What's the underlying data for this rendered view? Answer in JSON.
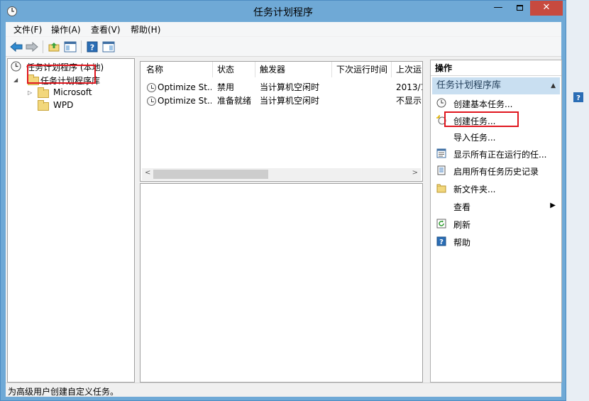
{
  "window": {
    "title": "任务计划程序",
    "min_glyph": "—",
    "close_glyph": "✕"
  },
  "menu": [
    "文件(F)",
    "操作(A)",
    "查看(V)",
    "帮助(H)"
  ],
  "tree": {
    "root": "任务计划程序 (本地)",
    "library": "任务计划程序库",
    "children": [
      "Microsoft",
      "WPD"
    ]
  },
  "task_table": {
    "columns": [
      "名称",
      "状态",
      "触发器",
      "下次运行时间",
      "上次运"
    ],
    "rows": [
      [
        "Optimize St...",
        "禁用",
        "当计算机空闲时",
        "",
        "2013/1"
      ],
      [
        "Optimize St...",
        "准备就绪",
        "当计算机空闲时",
        "",
        "不显示"
      ]
    ]
  },
  "actions": {
    "title": "操作",
    "section": "任务计划程序库",
    "items": [
      {
        "label": "创建基本任务...",
        "icon": "create-basic-task-icon"
      },
      {
        "label": "创建任务...",
        "icon": "create-task-icon"
      },
      {
        "label": "导入任务...",
        "icon": ""
      },
      {
        "label": "显示所有正在运行的任...",
        "icon": "running-tasks-icon"
      },
      {
        "label": "启用所有任务历史记录",
        "icon": "history-icon"
      },
      {
        "label": "新文件夹...",
        "icon": "new-folder-icon"
      },
      {
        "label": "查看",
        "icon": "",
        "submenu": true
      },
      {
        "label": "刷新",
        "icon": "refresh-icon"
      },
      {
        "label": "帮助",
        "icon": "help-icon"
      }
    ]
  },
  "status": "为高级用户创建自定义任务。",
  "colors": {
    "title_bg": "#6fa9d6",
    "close_bg": "#c74a3f",
    "section_bg": "#c9dff1",
    "highlight": "#e0161e"
  }
}
